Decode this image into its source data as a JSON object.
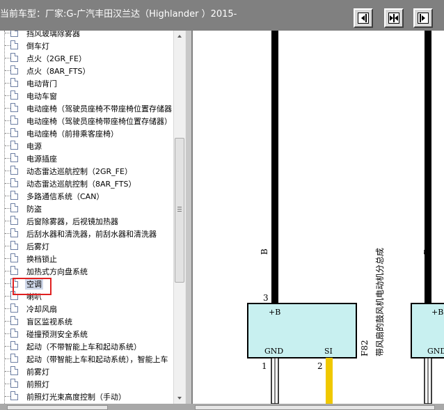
{
  "header": {
    "title": "当前车型：厂家:G-广汽丰田汉兰达（Highlander ）2015-",
    "buttons": [
      {
        "icon": "collapse-left-icon"
      },
      {
        "icon": "split-view-icon"
      },
      {
        "icon": "collapse-right-icon"
      }
    ]
  },
  "tree": {
    "items": [
      {
        "label": "挡风玻璃除雾器",
        "selected": false
      },
      {
        "label": "倒车灯",
        "selected": false
      },
      {
        "label": "点火（2GR_FE）",
        "selected": false
      },
      {
        "label": "点火（8AR_FTS）",
        "selected": false
      },
      {
        "label": "电动背门",
        "selected": false
      },
      {
        "label": "电动车窗",
        "selected": false
      },
      {
        "label": "电动座椅（驾驶员座椅不带座椅位置存储器",
        "selected": false
      },
      {
        "label": "电动座椅（驾驶员座椅带座椅位置存储器）",
        "selected": false
      },
      {
        "label": "电动座椅（前排乘客座椅）",
        "selected": false
      },
      {
        "label": "电源",
        "selected": false
      },
      {
        "label": "电源插座",
        "selected": false
      },
      {
        "label": "动态雷达巡航控制（2GR_FE）",
        "selected": false
      },
      {
        "label": "动态雷达巡航控制（8AR_FTS）",
        "selected": false
      },
      {
        "label": "多路通信系统（CAN）",
        "selected": false
      },
      {
        "label": "防盗",
        "selected": false
      },
      {
        "label": "后窗除雾器，后视镜加热器",
        "selected": false
      },
      {
        "label": "后刮水器和清洗器，前刮水器和清洗器",
        "selected": false
      },
      {
        "label": "后雾灯",
        "selected": false
      },
      {
        "label": "换档锁止",
        "selected": false
      },
      {
        "label": "加热式方向盘系统",
        "selected": false
      },
      {
        "label": "空调",
        "selected": true
      },
      {
        "label": "喇叭",
        "selected": false
      },
      {
        "label": "冷却风扇",
        "selected": false
      },
      {
        "label": "盲区监视系统",
        "selected": false
      },
      {
        "label": "碰撞预测安全系统",
        "selected": false
      },
      {
        "label": "起动（不带智能上车和起动系统）",
        "selected": false
      },
      {
        "label": "起动（带智能上车和起动系统），智能上车",
        "selected": false
      },
      {
        "label": "前雾灯",
        "selected": false
      },
      {
        "label": "前照灯",
        "selected": false
      },
      {
        "label": "前照灯光束高度控制（手动）",
        "selected": false
      }
    ]
  },
  "diagram": {
    "wire_color_label": "B",
    "wire_color_label_right": "B",
    "pin_top_left": "3",
    "pin_top_right": "1",
    "box_plus_b": "+B",
    "box_plus_b_right": "+B",
    "box_gnd": "GND",
    "box_si": "SI",
    "box_gnd_right": "GND",
    "pin_bottom_1": "1",
    "pin_bottom_2": "2",
    "pin_bottom_right": "6",
    "connector_code": "F82",
    "component_name": "带风扇的鼓风机电动机分总成",
    "colors": {
      "box_fill": "#c8f0f0",
      "wire_black": "#000000",
      "wire_yellow": "#f0c800"
    }
  }
}
